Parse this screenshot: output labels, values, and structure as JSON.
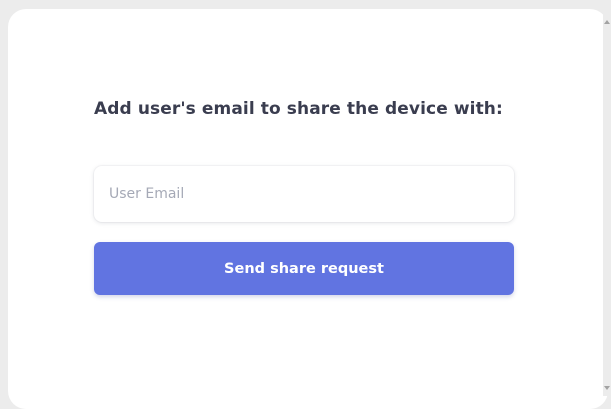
{
  "share_dialog": {
    "prompt": "Add user's email to share the device with:",
    "email_input": {
      "value": "",
      "placeholder": "User Email"
    },
    "send_button_label": "Send share request"
  },
  "colors": {
    "page_background": "#ececec",
    "dialog_background": "#ffffff",
    "prompt_text": "#3a3d4f",
    "placeholder_text": "#a5a9b6",
    "button_background": "#6174e1",
    "button_text": "#ffffff"
  },
  "icons": {
    "scroll_up": "scroll-up-arrow-icon",
    "scroll_down": "scroll-down-arrow-icon"
  }
}
